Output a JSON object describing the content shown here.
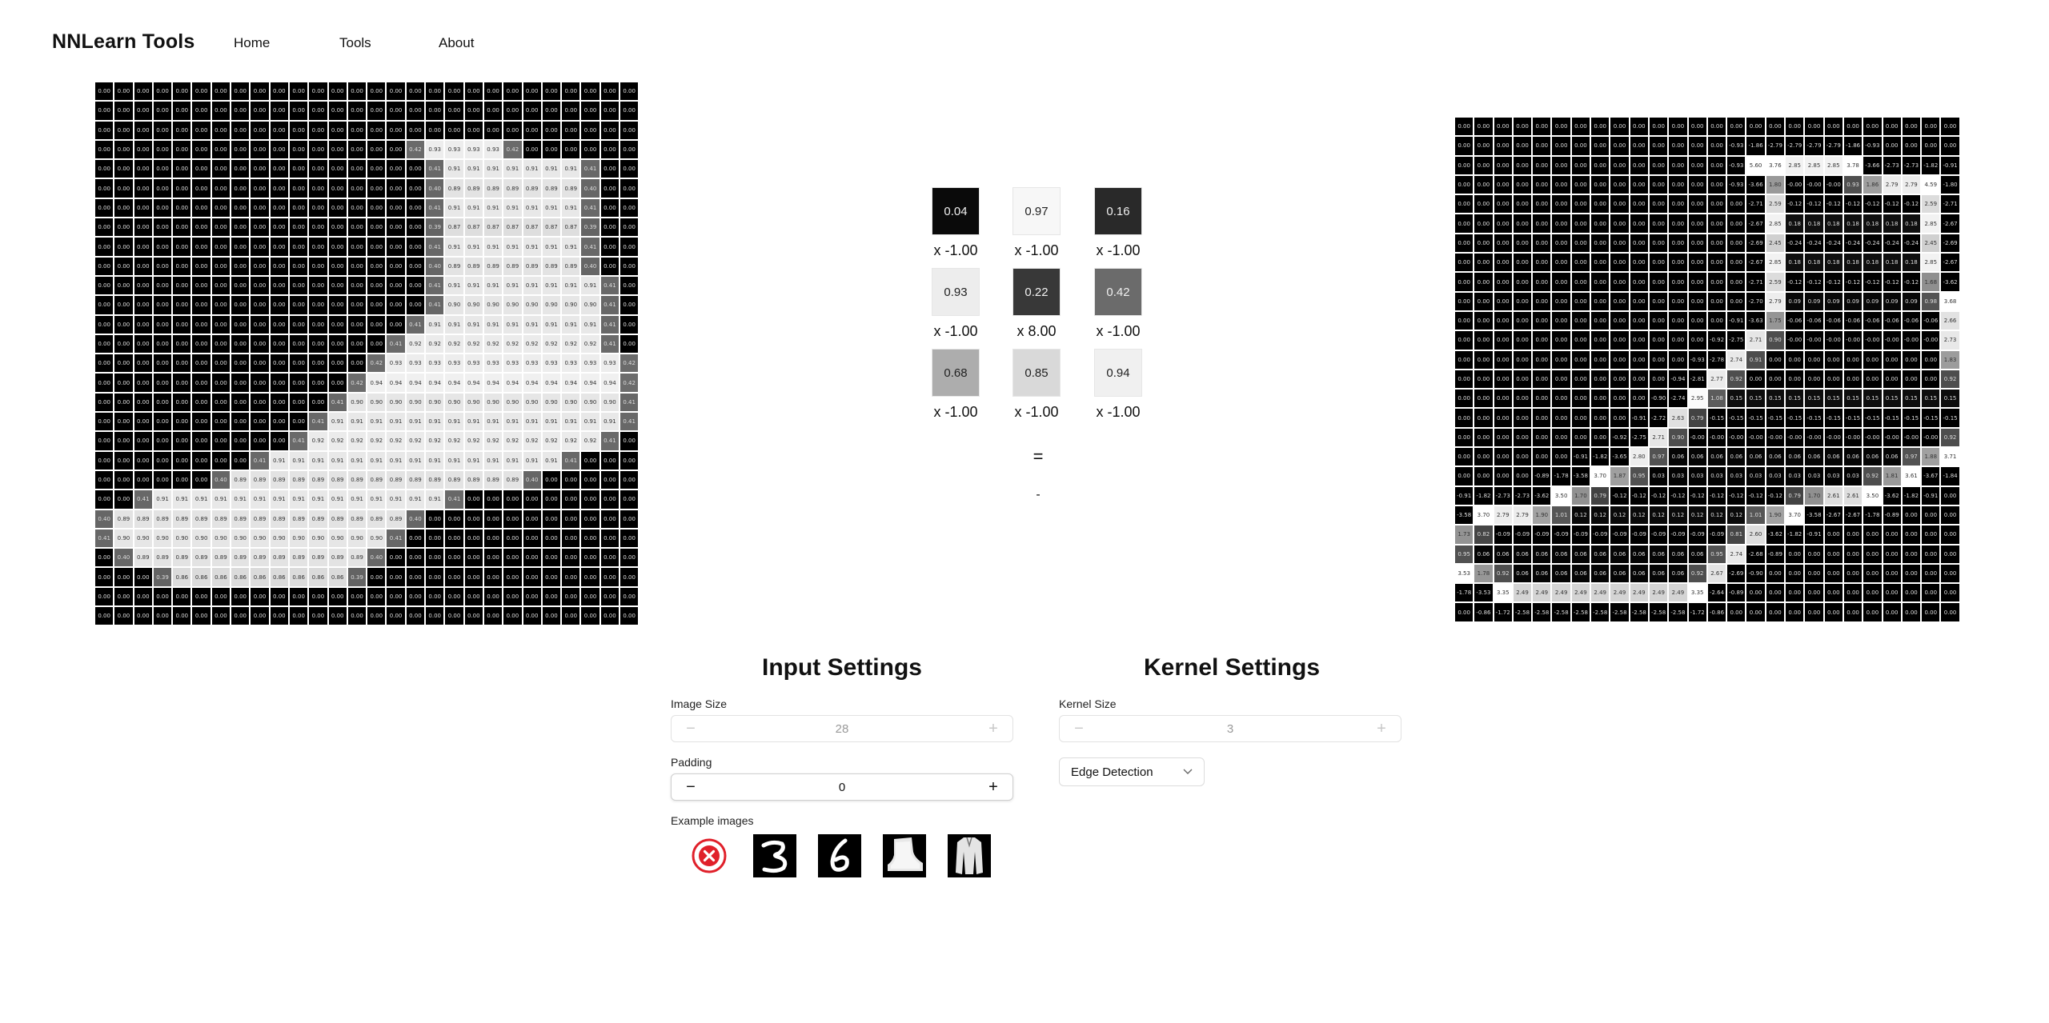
{
  "brand": "NNLearn Tools",
  "nav": {
    "home": "Home",
    "tools": "Tools",
    "about": "About"
  },
  "input_grid": {
    "rows": 28,
    "cols": 28,
    "bright_rows": [
      {
        "r": 3,
        "c": [
          16,
          21
        ],
        "v": "0.93"
      },
      {
        "r": 4,
        "c": [
          17,
          25
        ],
        "v": "0.91"
      },
      {
        "r": 5,
        "c": [
          17,
          25
        ],
        "v": "0.89"
      },
      {
        "r": 6,
        "c": [
          17,
          25
        ],
        "v": "0.91"
      },
      {
        "r": 7,
        "c": [
          17,
          25
        ],
        "v": "0.87"
      },
      {
        "r": 8,
        "c": [
          17,
          25
        ],
        "v": "0.91"
      },
      {
        "r": 9,
        "c": [
          17,
          25
        ],
        "v": "0.89"
      },
      {
        "r": 10,
        "c": [
          17,
          26
        ],
        "v": "0.91"
      },
      {
        "r": 11,
        "c": [
          17,
          26
        ],
        "v": "0.90"
      },
      {
        "r": 12,
        "c": [
          16,
          26
        ],
        "v": "0.91"
      },
      {
        "r": 13,
        "c": [
          15,
          26
        ],
        "v": "0.92"
      },
      {
        "r": 14,
        "c": [
          14,
          27
        ],
        "v": "0.93"
      },
      {
        "r": 15,
        "c": [
          13,
          27
        ],
        "v": "0.94"
      },
      {
        "r": 16,
        "c": [
          12,
          27
        ],
        "v": "0.90"
      },
      {
        "r": 17,
        "c": [
          11,
          27
        ],
        "v": "0.91"
      },
      {
        "r": 18,
        "c": [
          10,
          26
        ],
        "v": "0.92"
      },
      {
        "r": 19,
        "c": [
          8,
          24
        ],
        "v": "0.91"
      },
      {
        "r": 20,
        "c": [
          6,
          22
        ],
        "v": "0.89"
      },
      {
        "r": 21,
        "c": [
          2,
          18
        ],
        "v": "0.91"
      },
      {
        "r": 22,
        "c": [
          0,
          16
        ],
        "v": "0.89"
      },
      {
        "r": 23,
        "c": [
          0,
          15
        ],
        "v": "0.90"
      },
      {
        "r": 24,
        "c": [
          1,
          14
        ],
        "v": "0.89"
      },
      {
        "r": 25,
        "c": [
          3,
          13
        ],
        "v": "0.86"
      }
    ]
  },
  "kernel": {
    "cells": [
      "0.04",
      "0.97",
      "0.16",
      "0.93",
      "0.22",
      "0.42",
      "0.68",
      "0.85",
      "0.94"
    ],
    "weights": [
      "x -1.00",
      "x -1.00",
      "x -1.00",
      "x -1.00",
      "x 8.00",
      "x -1.00",
      "x -1.00",
      "x -1.00",
      "x -1.00"
    ],
    "equals": "=",
    "result": "-"
  },
  "output_grid": {
    "rows": 26,
    "cols": 26
  },
  "input_settings": {
    "title": "Input Settings",
    "image_size_label": "Image Size",
    "image_size_value": "28",
    "padding_label": "Padding",
    "padding_value": "0",
    "examples_label": "Example images"
  },
  "kernel_settings": {
    "title": "Kernel Settings",
    "kernel_size_label": "Kernel Size",
    "kernel_size_value": "3",
    "kernel_type": "Edge Detection"
  },
  "colors": {
    "accent_red": "#e0202a",
    "cell_dark": "#000000",
    "cell_light": "#ffffff"
  }
}
